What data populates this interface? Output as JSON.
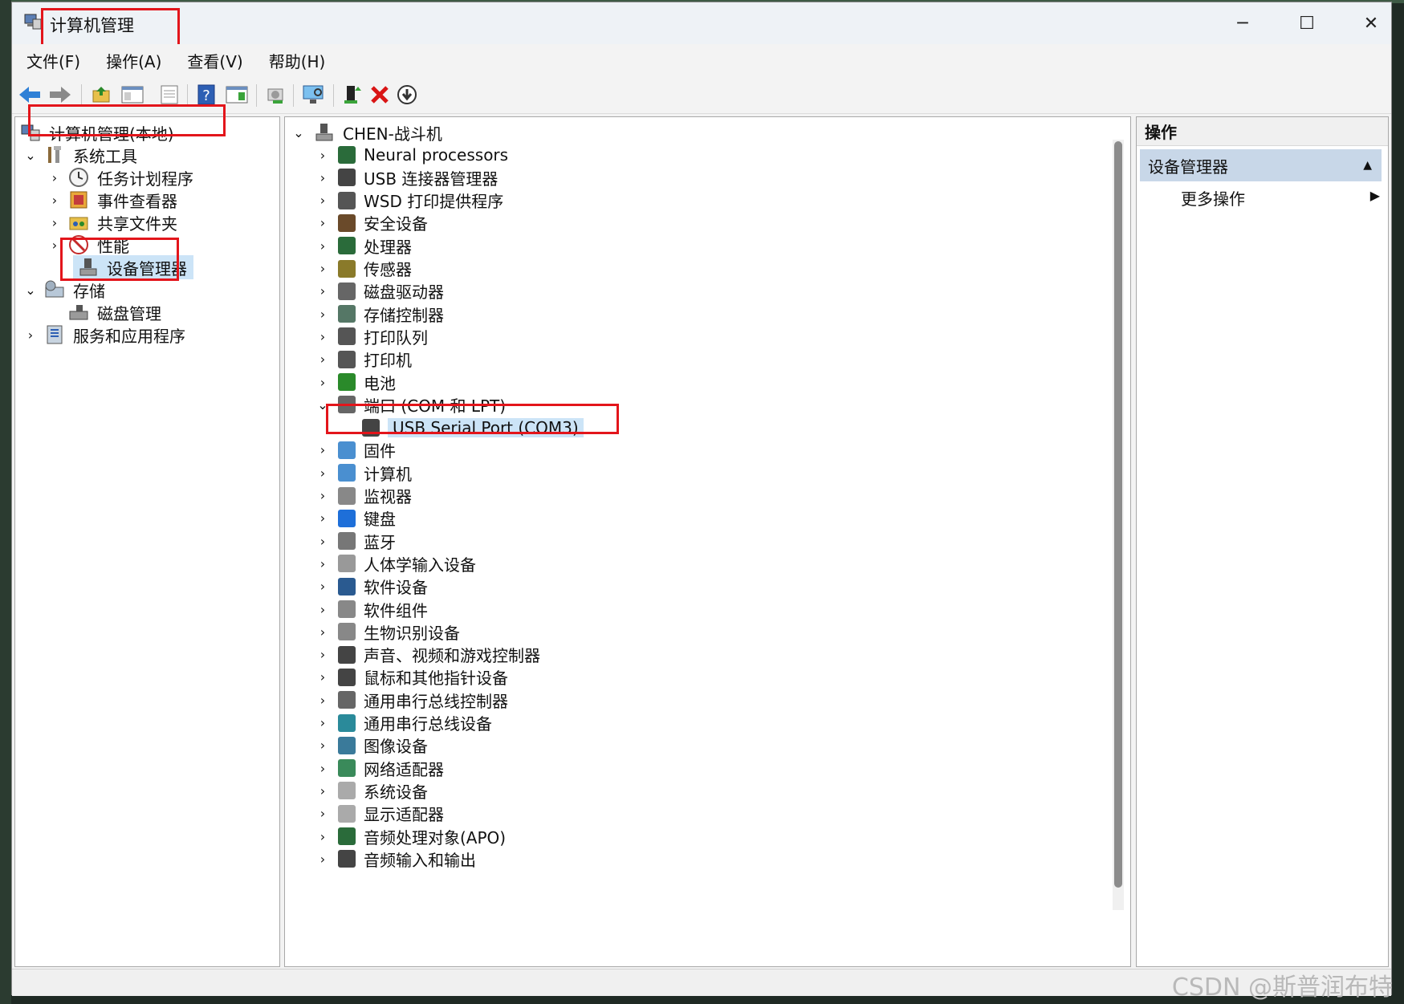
{
  "window": {
    "title": "计算机管理"
  },
  "menu": [
    "文件(F)",
    "操作(A)",
    "查看(V)",
    "帮助(H)"
  ],
  "toolbar": [
    "back-icon",
    "forward-icon",
    "up-folder-icon",
    "show-hide-tree-icon",
    "export-list-icon",
    "help-icon",
    "show-action-pane-icon",
    "properties-icon",
    "scan-hardware-icon",
    "update-driver-icon",
    "uninstall-device-icon",
    "disable-device-icon"
  ],
  "left_tree": {
    "root": "计算机管理(本地)",
    "system_tools": "系统工具",
    "task_scheduler": "任务计划程序",
    "event_viewer": "事件查看器",
    "shared_folders": "共享文件夹",
    "performance": "性能",
    "device_manager": "设备管理器",
    "storage": "存储",
    "disk_management": "磁盘管理",
    "services_apps": "服务和应用程序"
  },
  "device_tree": {
    "computer": "CHEN-战斗机",
    "categories": [
      "Neural processors",
      "USB 连接器管理器",
      "WSD 打印提供程序",
      "安全设备",
      "处理器",
      "传感器",
      "磁盘驱动器",
      "存储控制器",
      "打印队列",
      "打印机",
      "电池",
      "端口 (COM 和 LPT)"
    ],
    "expanded_child": "USB Serial Port (COM3)",
    "categories_after": [
      "固件",
      "计算机",
      "监视器",
      "键盘",
      "蓝牙",
      "人体学输入设备",
      "软件设备",
      "软件组件",
      "生物识别设备",
      "声音、视频和游戏控制器",
      "鼠标和其他指针设备",
      "通用串行总线控制器",
      "通用串行总线设备",
      "图像设备",
      "网络适配器",
      "系统设备",
      "显示适配器",
      "音频处理对象(APO)",
      "音频输入和输出"
    ]
  },
  "actions": {
    "header": "操作",
    "section": "设备管理器",
    "more": "更多操作"
  },
  "watermark": "CSDN @斯普润布特",
  "colors": {
    "highlight": "#e3151b",
    "selection": "#cce4f7",
    "section": "#c8d7e8"
  }
}
